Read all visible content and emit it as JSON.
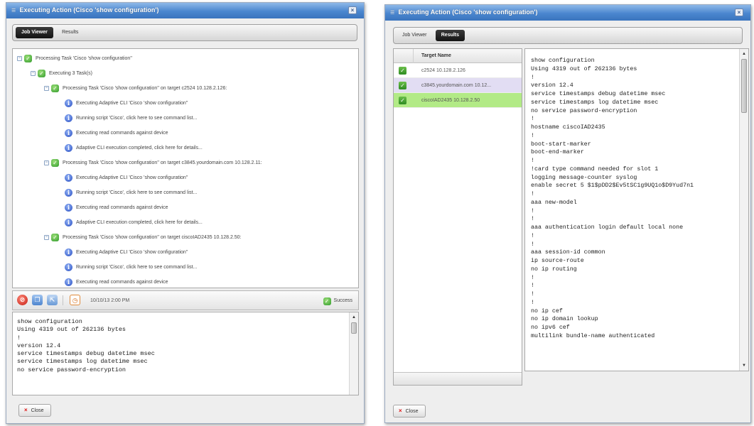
{
  "left": {
    "title": "Executing Action (Cisco 'show configuration')",
    "close_glyph": "×",
    "tabs": [
      {
        "label": "Job Viewer",
        "active": true
      },
      {
        "label": "Results",
        "active": false
      }
    ],
    "tree": [
      {
        "text": "Processing Task 'Cisco 'show configuration''",
        "icon": "ok",
        "expander": "−",
        "level": 0
      },
      {
        "text": "Executing 3 Task(s)",
        "icon": "ok",
        "expander": "−",
        "level": 1
      },
      {
        "text": "Processing Task 'Cisco 'show configuration'' on target c2524 10.128.2.126:",
        "icon": "ok",
        "expander": "−",
        "level": 2
      },
      {
        "text": "Executing Adaptive CLI 'Cisco 'show configuration''",
        "icon": "info",
        "level": 3
      },
      {
        "text": "Running script 'Cisco', click here to see command list...",
        "icon": "info",
        "level": 3
      },
      {
        "text": "Executing read commands against device",
        "icon": "info",
        "level": 3
      },
      {
        "text": "Adaptive CLI execution completed, click here for details...",
        "icon": "info",
        "level": 3
      },
      {
        "text": "Processing Task 'Cisco 'show configuration'' on target c3845.yourdomain.com 10.128.2.11:",
        "icon": "ok",
        "expander": "−",
        "level": 2
      },
      {
        "text": "Executing Adaptive CLI 'Cisco 'show configuration''",
        "icon": "info",
        "level": 3
      },
      {
        "text": "Running script 'Cisco', click here to see command list...",
        "icon": "info",
        "level": 3
      },
      {
        "text": "Executing read commands against device",
        "icon": "info",
        "level": 3
      },
      {
        "text": "Adaptive CLI execution completed, click here for details...",
        "icon": "info",
        "level": 3
      },
      {
        "text": "Processing Task 'Cisco 'show configuration'' on target ciscoIAD2435 10.128.2.50:",
        "icon": "ok",
        "expander": "−",
        "level": 2
      },
      {
        "text": "Executing Adaptive CLI 'Cisco 'show configuration''",
        "icon": "info",
        "level": 3
      },
      {
        "text": "Running script 'Cisco', click here to see command list...",
        "icon": "info",
        "level": 3
      },
      {
        "text": "Executing read commands against device",
        "icon": "info",
        "level": 3
      },
      {
        "text": "Adaptive CLI execution completed, click here for details...",
        "icon": "info",
        "level": 3,
        "bold": true
      }
    ],
    "toolbar": {
      "timestamp": "10/10/13 2:00 PM",
      "status": "Success"
    },
    "output": "show configuration\nUsing 4319 out of 262136 bytes\n!\nversion 12.4\nservice timestamps debug datetime msec\nservice timestamps log datetime msec\nno service password-encryption",
    "close_label": "Close"
  },
  "right": {
    "title": "Executing Action (Cisco 'show configuration')",
    "close_glyph": "×",
    "tabs": [
      {
        "label": "Job Viewer",
        "active": false
      },
      {
        "label": "Results",
        "active": true
      }
    ],
    "targets_header": "Target Name",
    "targets": [
      {
        "name": "c2524 10.128.2.126",
        "state": "none"
      },
      {
        "name": "c3845.yourdomain.com 10.12...",
        "state": "lilac"
      },
      {
        "name": "ciscoIAD2435 10.128.2.50",
        "state": "green"
      }
    ],
    "output": "show configuration\nUsing 4319 out of 262136 bytes\n!\nversion 12.4\nservice timestamps debug datetime msec\nservice timestamps log datetime msec\nno service password-encryption\n!\nhostname ciscoIAD2435\n!\nboot-start-marker\nboot-end-marker\n!\n!card type command needed for slot 1\nlogging message-counter syslog\nenable secret 5 $1$pDD2$Ev5tSC1g9UQ1o$D9Yud7n1\n!\naaa new-model\n!\n!\naaa authentication login default local none\n!\n!\naaa session-id common\nip source-route\nno ip routing\n!\n!\n!\n!\nno ip cef\nno ip domain lookup\nno ipv6 cef\nmultilink bundle-name authenticated",
    "close_label": "Close"
  }
}
